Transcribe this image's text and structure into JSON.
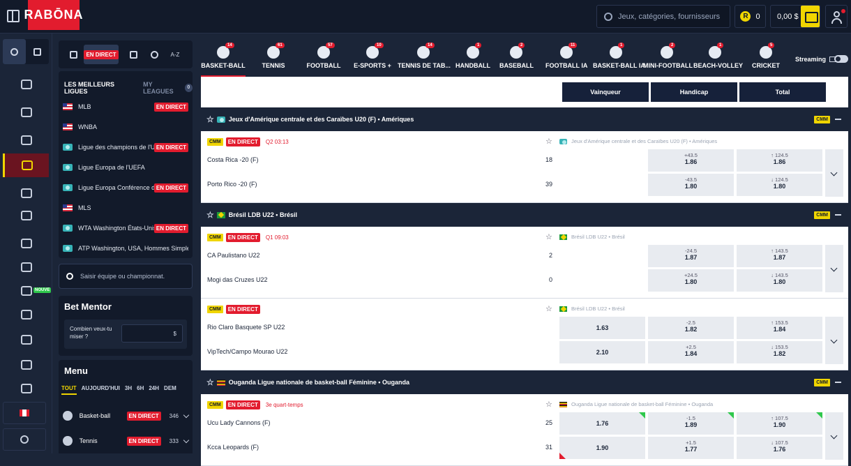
{
  "topbar": {
    "logo": "RABŌNA",
    "search_placeholder": "Jeux, catégories, fournisseurs",
    "coins": "0",
    "coins_icon": "R",
    "balance": "0,00 $"
  },
  "rail": {
    "new_badge": "NOUVE"
  },
  "left": {
    "tabs": {
      "live": "EN DIRECT",
      "az": "A-Z"
    },
    "leagues_tab": "LES MEILLEURS LIGUES",
    "my_leagues_tab": "MY LEAGUES",
    "my_leagues_count": "0",
    "leagues": [
      {
        "name": "MLB",
        "flag": "us",
        "live": "EN DIRECT"
      },
      {
        "name": "WNBA",
        "flag": "us",
        "live": ""
      },
      {
        "name": "Ligue des champions de l'UE...",
        "flag": "eu",
        "live": "EN DIRECT"
      },
      {
        "name": "Ligue Europa de l'UEFA",
        "flag": "eu",
        "live": ""
      },
      {
        "name": "Ligue Europa Conférence de l...",
        "flag": "eu",
        "live": "EN DIRECT"
      },
      {
        "name": "MLS",
        "flag": "us",
        "live": ""
      },
      {
        "name": "WTA Washington États-Unis ...",
        "flag": "eu",
        "live": "EN DIRECT"
      },
      {
        "name": "ATP Washington, USA, Hommes Simple",
        "flag": "eu",
        "live": ""
      }
    ],
    "team_search_placeholder": "Saisir équipe ou championnat.",
    "bet_mentor": {
      "title": "Bet Mentor",
      "question": "Combien veux-tu miser ?",
      "currency": "$"
    },
    "menu": {
      "title": "Menu",
      "tabs": [
        "TOUT",
        "AUJOURD'HUI",
        "3H",
        "6H",
        "24H",
        "DEM"
      ],
      "items": [
        {
          "name": "Basket-ball",
          "live": "EN DIRECT",
          "count": "346"
        },
        {
          "name": "Tennis",
          "live": "EN DIRECT",
          "count": "333"
        }
      ]
    }
  },
  "sports": [
    {
      "name": "BASKET-BALL",
      "count": "14",
      "active": true
    },
    {
      "name": "TENNIS",
      "count": "61"
    },
    {
      "name": "FOOTBALL",
      "count": "57"
    },
    {
      "name": "E-SPORTS +",
      "count": "10"
    },
    {
      "name": "TENNIS DE TAB...",
      "count": "14"
    },
    {
      "name": "HANDBALL",
      "count": "1"
    },
    {
      "name": "BASEBALL",
      "count": "2"
    },
    {
      "name": "FOOTBALL IA",
      "count": "11"
    },
    {
      "name": "BASKET-BALL IA",
      "count": "1"
    },
    {
      "name": "MINI-FOOTBALL",
      "count": "2"
    },
    {
      "name": "BEACH-VOLLEY",
      "count": "1"
    },
    {
      "name": "CRICKET",
      "count": "5"
    }
  ],
  "streaming_label": "Streaming",
  "market_headers": [
    "Vainqueur",
    "Handicap",
    "Total"
  ],
  "groups": [
    {
      "league": "Jeux d'Amérique centrale et des Caraïbes U20 (F) • Amériques",
      "cmm": "CMM",
      "matches": [
        {
          "cmm": "CMM",
          "live": "EN DIRECT",
          "time": "Q2 03:13",
          "sub": "Jeux d'Amérique centrale et des Caraïbes U20 (F) • Amériques",
          "home": "Costa Rica -20 (F)",
          "away": "Porto Rico -20 (F)",
          "home_score": "18",
          "away_score": "39",
          "win": [
            "",
            ""
          ],
          "hcp": [
            {
              "line": "+43.5",
              "odd": "1.86"
            },
            {
              "line": "-43.5",
              "odd": "1.80"
            }
          ],
          "tot": [
            {
              "line": "↑ 124.5",
              "odd": "1.86"
            },
            {
              "line": "↓ 124.5",
              "odd": "1.80"
            }
          ]
        }
      ]
    },
    {
      "league": "Brésil LDB U22 • Brésil",
      "cmm": "CMM",
      "matches": [
        {
          "cmm": "CMM",
          "live": "EN DIRECT",
          "time": "Q1 09:03",
          "sub": "Brésil LDB U22 • Brésil",
          "home": "CA Paulistano U22",
          "away": "Mogi das Cruzes U22",
          "home_score": "2",
          "away_score": "0",
          "win": [
            "",
            ""
          ],
          "hcp": [
            {
              "line": "-24.5",
              "odd": "1.87"
            },
            {
              "line": "+24.5",
              "odd": "1.80"
            }
          ],
          "tot": [
            {
              "line": "↑ 143.5",
              "odd": "1.87"
            },
            {
              "line": "↓ 143.5",
              "odd": "1.80"
            }
          ]
        },
        {
          "cmm": "CMM",
          "live": "EN DIRECT",
          "time": "",
          "sub": "Brésil LDB U22 • Brésil",
          "home": "Rio Claro Basquete SP U22",
          "away": "VipTech/Campo Mourao U22",
          "home_score": "",
          "away_score": "",
          "win": [
            "1.63",
            "2.10"
          ],
          "hcp": [
            {
              "line": "-2.5",
              "odd": "1.82"
            },
            {
              "line": "+2.5",
              "odd": "1.84"
            }
          ],
          "tot": [
            {
              "line": "↑ 153.5",
              "odd": "1.84"
            },
            {
              "line": "↓ 153.5",
              "odd": "1.82"
            }
          ]
        }
      ]
    },
    {
      "league": "Ouganda Ligue nationale de basket-ball Féminine • Ouganda",
      "cmm": "CMM",
      "matches": [
        {
          "cmm": "CMM",
          "live": "EN DIRECT",
          "time": "3e quart-temps",
          "sub": "Ouganda Ligue nationale de basket-ball Féminine • Ouganda",
          "home": "Ucu Lady Cannons (F)",
          "away": "Kcca Leopards (F)",
          "home_score": "25",
          "away_score": "31",
          "win": [
            "1.76",
            "1.90"
          ],
          "hcp": [
            {
              "line": "-1.5",
              "odd": "1.89"
            },
            {
              "line": "+1.5",
              "odd": "1.77"
            }
          ],
          "tot": [
            {
              "line": "↑ 107.5",
              "odd": "1.90"
            },
            {
              "line": "↓ 107.5",
              "odd": "1.76"
            }
          ]
        }
      ]
    }
  ]
}
